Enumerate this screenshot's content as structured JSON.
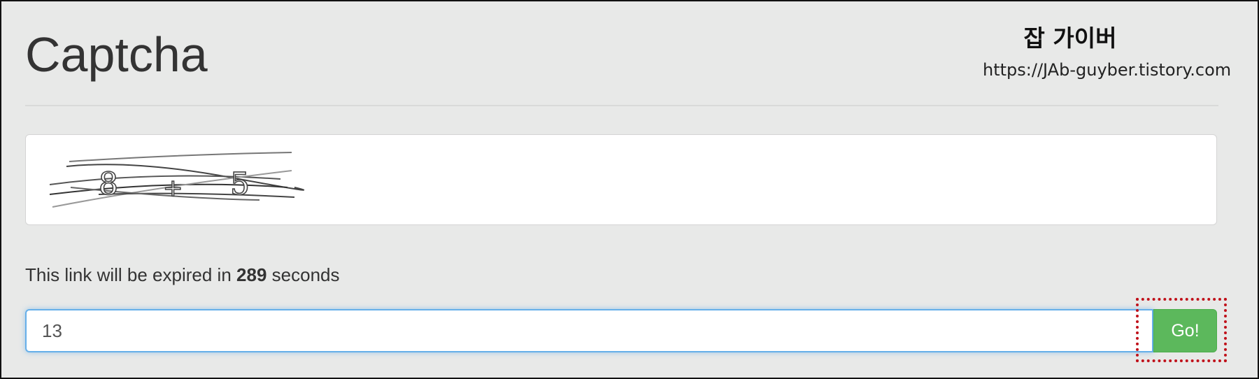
{
  "header": {
    "title": "Captcha"
  },
  "watermark": {
    "name": "잡 가이버",
    "url": "https://JAb-guyber.tistory.com"
  },
  "captcha": {
    "left_operand": "8",
    "operator": "+",
    "right_operand": "5"
  },
  "expiry": {
    "prefix": "This link will be expired in",
    "seconds": "289",
    "suffix": "seconds"
  },
  "form": {
    "answer_value": "13",
    "go_label": "Go!"
  },
  "colors": {
    "background": "#e8e9e8",
    "go_button": "#5cb85c",
    "input_focus_border": "#66afe9",
    "highlight": "#c0121b"
  }
}
